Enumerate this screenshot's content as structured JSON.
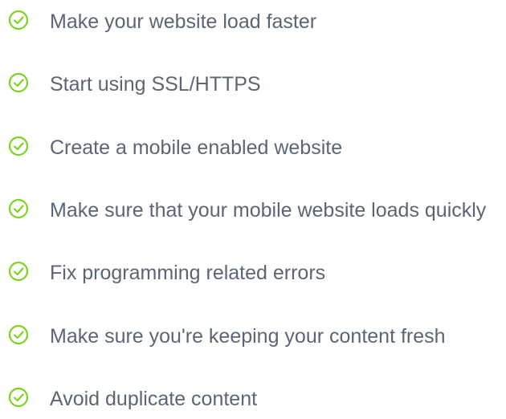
{
  "icon": "check-circle-icon",
  "accent_color": "#7ed321",
  "text_color": "#5b6675",
  "items": [
    {
      "label": "Make your website load faster"
    },
    {
      "label": "Start using SSL/HTTPS"
    },
    {
      "label": "Create a mobile enabled website"
    },
    {
      "label": "Make sure that your mobile website loads quickly"
    },
    {
      "label": "Fix programming related errors"
    },
    {
      "label": "Make sure you're keeping your content fresh"
    },
    {
      "label": "Avoid duplicate content"
    }
  ]
}
